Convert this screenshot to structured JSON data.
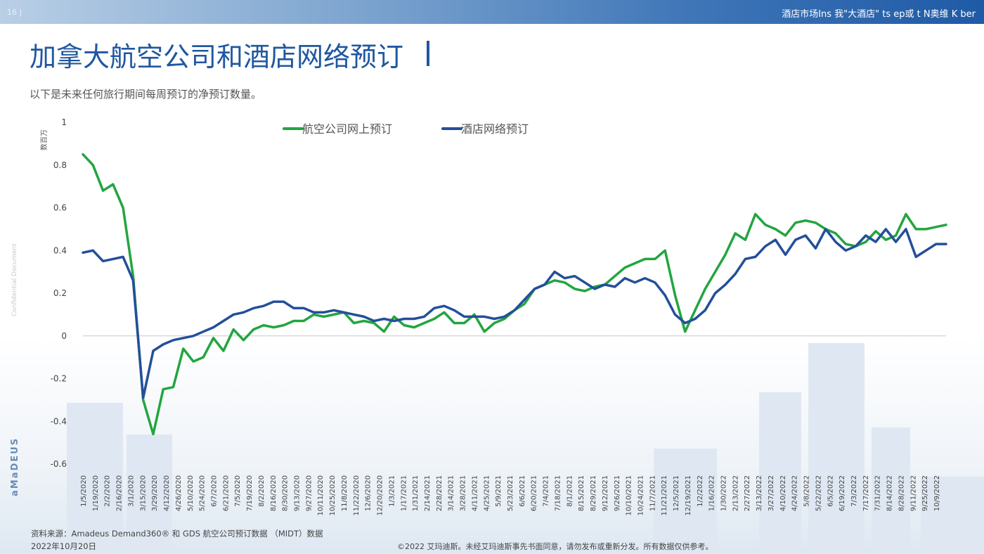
{
  "header": {
    "page_number": "16 |",
    "banner_text": "酒店市场Ins 我\"大酒店\" ts ep或 t N奥维 K ber"
  },
  "title": "加拿大航空公司和酒店网络预订",
  "subtitle": "以下是未来任何旅行期间每周预订的净预订数量。",
  "side_label": "Confidential Document",
  "logo": "aMaDEUS",
  "source": {
    "line1": "资料来源：Amadeus Demand360® 和 GDS 航空公司预订数据 （MIDT）数据",
    "line2": "2022年10月20日"
  },
  "footer": "©2022 艾玛迪斯。未经艾玛迪斯事先书面同意，请勿发布或重新分发。所有数据仅供参考。",
  "colors": {
    "air": "#23a540",
    "hotel": "#234f9a",
    "axis_text": "#444444",
    "zero_line": "#c8c8c8"
  },
  "chart_data": {
    "type": "line",
    "ylabel": "数百万",
    "ylim": [
      -0.6,
      1
    ],
    "yticks": [
      "1",
      "0.8",
      "0.6",
      "0.4",
      "0.2",
      "0",
      "-0.2",
      "-0.4",
      "-0.6"
    ],
    "ytick_values": [
      1,
      0.8,
      0.6,
      0.4,
      0.2,
      0,
      -0.2,
      -0.4,
      -0.6
    ],
    "legend_position": "top-center",
    "categories": [
      "1/5/2020",
      "1/19/2020",
      "2/2/2020",
      "2/16/2020",
      "3/1/2020",
      "3/15/2020",
      "3/29/2020",
      "4/12/2020",
      "4/26/2020",
      "5/10/2020",
      "5/24/2020",
      "6/7/2020",
      "6/21/2020",
      "7/5/2020",
      "7/19/2020",
      "8/2/2020",
      "8/16/2020",
      "8/30/2020",
      "9/13/2020",
      "9/27/2020",
      "10/11/2020",
      "10/25/2020",
      "11/8/2020",
      "11/22/2020",
      "12/6/2020",
      "12/20/2020",
      "1/3/2021",
      "1/17/2021",
      "1/31/2021",
      "2/14/2021",
      "2/28/2021",
      "3/14/2021",
      "3/28/2021",
      "4/11/2021",
      "4/25/2021",
      "5/9/2021",
      "5/23/2021",
      "6/6/2021",
      "6/20/2021",
      "7/4/2021",
      "7/18/2021",
      "8/1/2021",
      "8/15/2021",
      "8/29/2021",
      "9/12/2021",
      "9/26/2021",
      "10/10/2021",
      "10/24/2021",
      "11/7/2021",
      "11/21/2021",
      "12/5/2021",
      "12/19/2021",
      "1/2/2022",
      "1/16/2022",
      "1/30/2022",
      "2/13/2022",
      "2/27/2022",
      "3/13/2022",
      "3/27/2022",
      "4/10/2022",
      "4/24/2022",
      "5/8/2022",
      "5/22/2022",
      "6/5/2022",
      "6/19/2022",
      "7/3/2022",
      "7/17/2022",
      "7/31/2022",
      "8/14/2022",
      "8/28/2022",
      "9/11/2022",
      "9/25/2022",
      "10/9/2022"
    ],
    "series": [
      {
        "name": "航空公司网上预订",
        "color": "#23a540",
        "values": [
          0.85,
          0.8,
          0.68,
          0.71,
          0.6,
          0.28,
          -0.3,
          -0.46,
          -0.25,
          -0.24,
          -0.06,
          -0.12,
          -0.1,
          -0.01,
          -0.07,
          0.03,
          -0.02,
          0.03,
          0.05,
          0.04,
          0.05,
          0.07,
          0.07,
          0.1,
          0.09,
          0.1,
          0.11,
          0.06,
          0.07,
          0.06,
          0.02,
          0.09,
          0.05,
          0.04,
          0.06,
          0.08,
          0.11,
          0.06,
          0.06,
          0.1,
          0.02,
          0.06,
          0.08,
          0.12,
          0.15,
          0.22,
          0.24,
          0.26,
          0.25,
          0.22,
          0.21,
          0.23,
          0.24,
          0.28,
          0.32,
          0.34,
          0.36,
          0.36,
          0.4,
          0.19,
          0.02,
          0.12,
          0.22,
          0.3,
          0.38,
          0.48,
          0.45,
          0.57,
          0.52,
          0.5,
          0.47,
          0.53,
          0.54,
          0.53,
          0.5,
          0.48,
          0.43,
          0.42,
          0.44,
          0.49,
          0.45,
          0.47,
          0.57,
          0.5,
          0.5,
          0.51,
          0.52
        ]
      },
      {
        "name": "酒店网络预订",
        "color": "#234f9a",
        "values": [
          0.39,
          0.4,
          0.35,
          0.36,
          0.37,
          0.26,
          -0.29,
          -0.07,
          -0.04,
          -0.02,
          -0.01,
          0,
          0.02,
          0.04,
          0.07,
          0.1,
          0.11,
          0.13,
          0.14,
          0.16,
          0.16,
          0.13,
          0.13,
          0.11,
          0.11,
          0.12,
          0.11,
          0.1,
          0.09,
          0.07,
          0.08,
          0.07,
          0.08,
          0.08,
          0.09,
          0.13,
          0.14,
          0.12,
          0.09,
          0.09,
          0.09,
          0.08,
          0.09,
          0.12,
          0.17,
          0.22,
          0.24,
          0.3,
          0.27,
          0.28,
          0.25,
          0.22,
          0.24,
          0.23,
          0.27,
          0.25,
          0.27,
          0.25,
          0.19,
          0.1,
          0.06,
          0.08,
          0.12,
          0.2,
          0.24,
          0.29,
          0.36,
          0.37,
          0.42,
          0.45,
          0.38,
          0.45,
          0.47,
          0.41,
          0.5,
          0.44,
          0.4,
          0.42,
          0.47,
          0.44,
          0.5,
          0.44,
          0.5,
          0.37,
          0.4,
          0.43,
          0.43
        ]
      }
    ]
  }
}
